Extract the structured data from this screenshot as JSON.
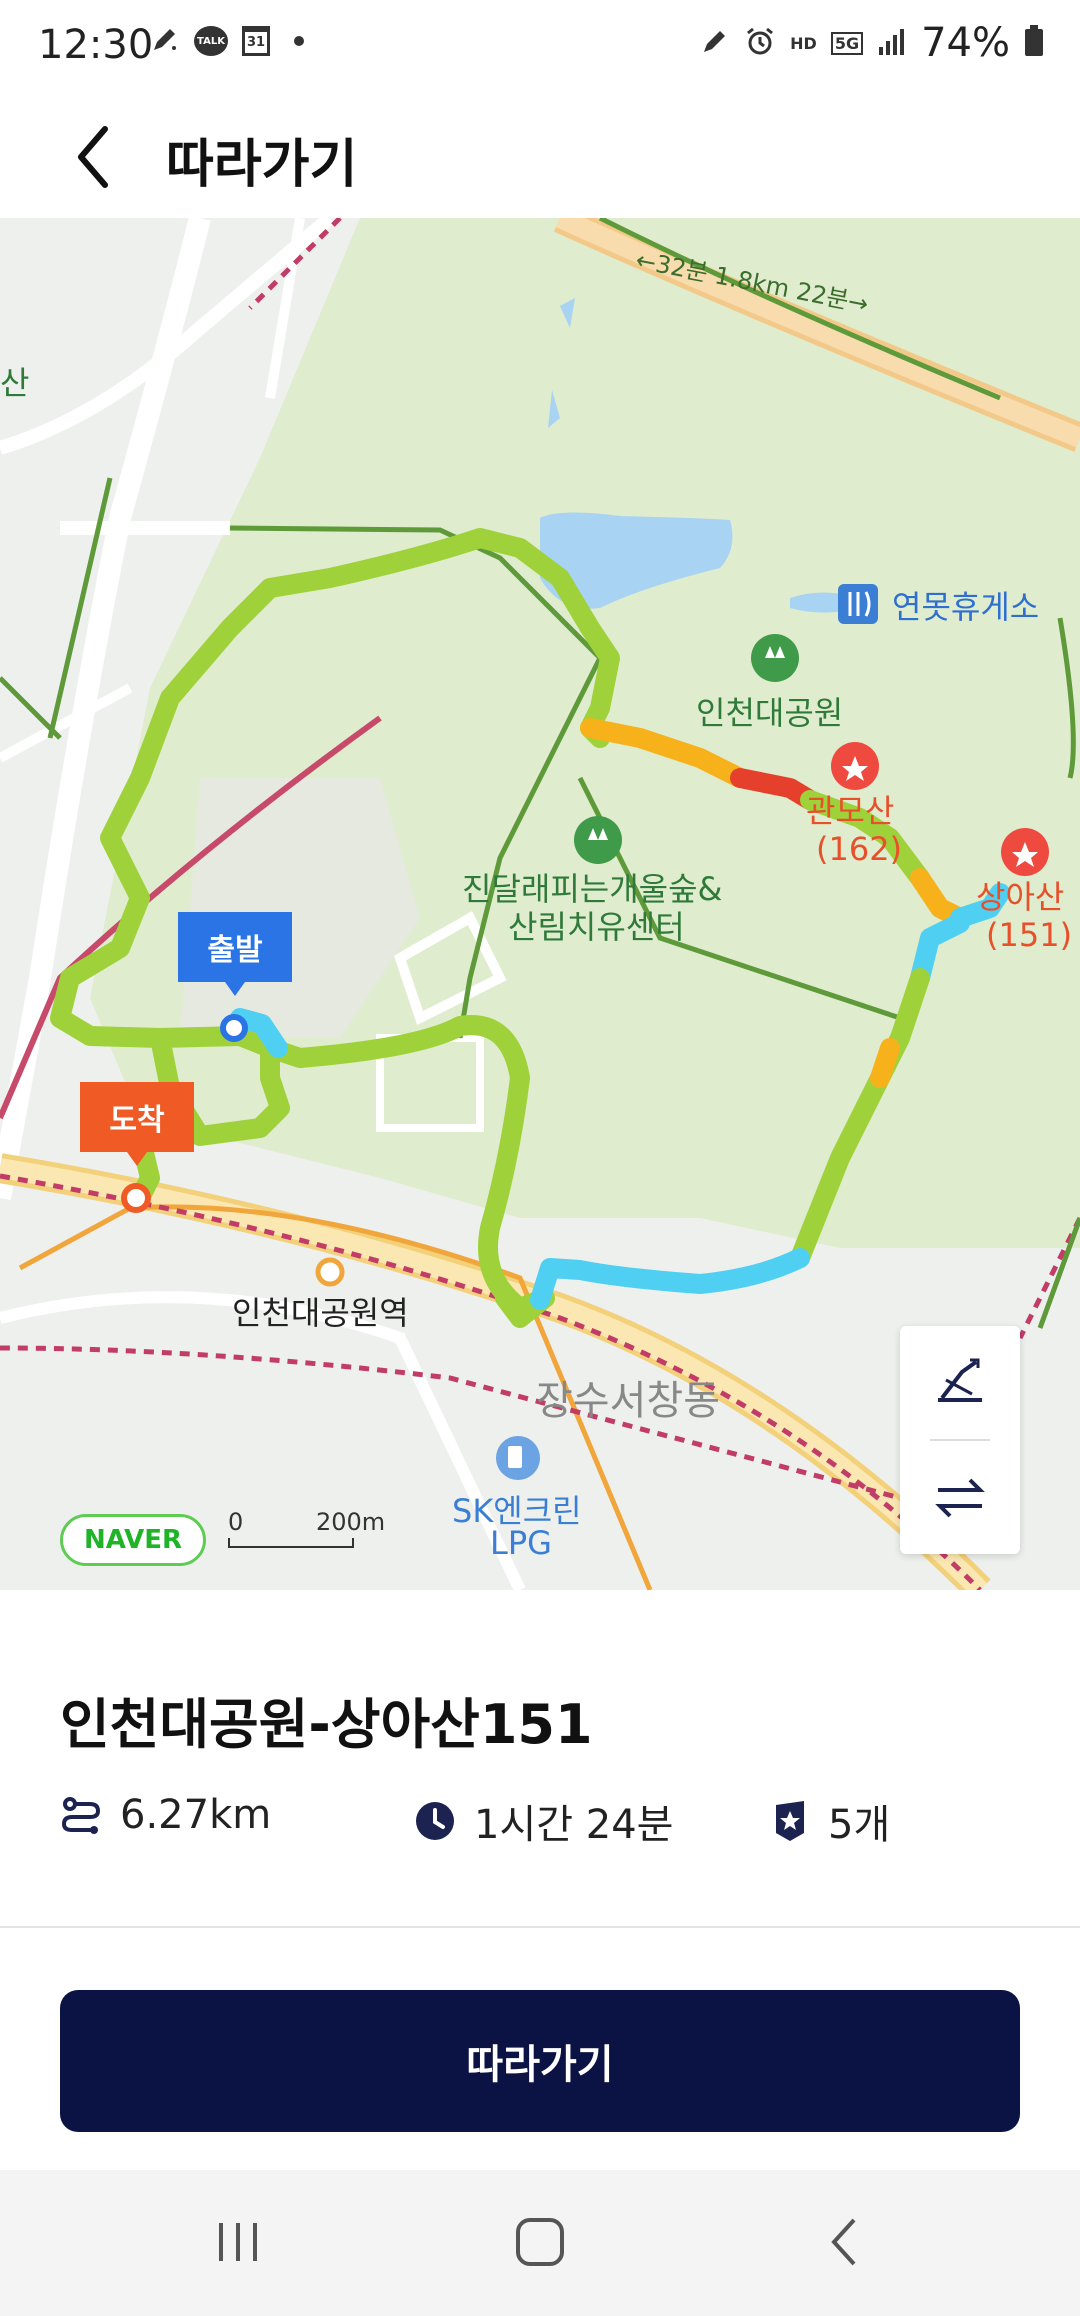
{
  "status_bar": {
    "time": "12:30",
    "battery": "74%",
    "left_icons": [
      "pen-icon",
      "talk-icon",
      "calendar-icon",
      "dot-icon"
    ],
    "talk_badge": "TALK",
    "calendar_badge": "31",
    "right_icons": [
      "pen-icon",
      "alarm-icon",
      "hd-voice-icon",
      "5g-icon",
      "signal-icon",
      "battery-icon"
    ],
    "hd_badge": "HD",
    "fiveg_badge": "5G"
  },
  "app_bar": {
    "title": "따라가기"
  },
  "map": {
    "road_label": "←32분 1.8km 22분→",
    "edge_label": "산",
    "rest_area": "연못휴게소",
    "park": "인천대공원",
    "forest_center_line1": "진달래피는개울숲&",
    "forest_center_line2": "산림치유센터",
    "peak1_name": "관모산",
    "peak1_height": "(162)",
    "peak2_name": "상아산",
    "peak2_height": "(151)",
    "start_tag": "출발",
    "end_tag": "도착",
    "station": "인천대공원역",
    "district": "장수서창동",
    "gas_line1": "SK엔크린",
    "gas_line2": "LPG",
    "naver": "NAVER",
    "scale_zero": "0",
    "scale_distance": "200m",
    "colors": {
      "route_green": "#9fd23a",
      "route_orange": "#f7b21b",
      "route_red": "#e4402c",
      "route_blue": "#4fcff2",
      "park_fill": "#dfeccd",
      "water": "#a9d3f2"
    }
  },
  "course": {
    "title": "인천대공원-상아산151",
    "distance": "6.27km",
    "duration": "1시간 24분",
    "peaks": "5개"
  },
  "actions": {
    "follow_label": "따라가기"
  },
  "nav": {
    "icons": [
      "recents-icon",
      "home-icon",
      "back-icon"
    ]
  }
}
